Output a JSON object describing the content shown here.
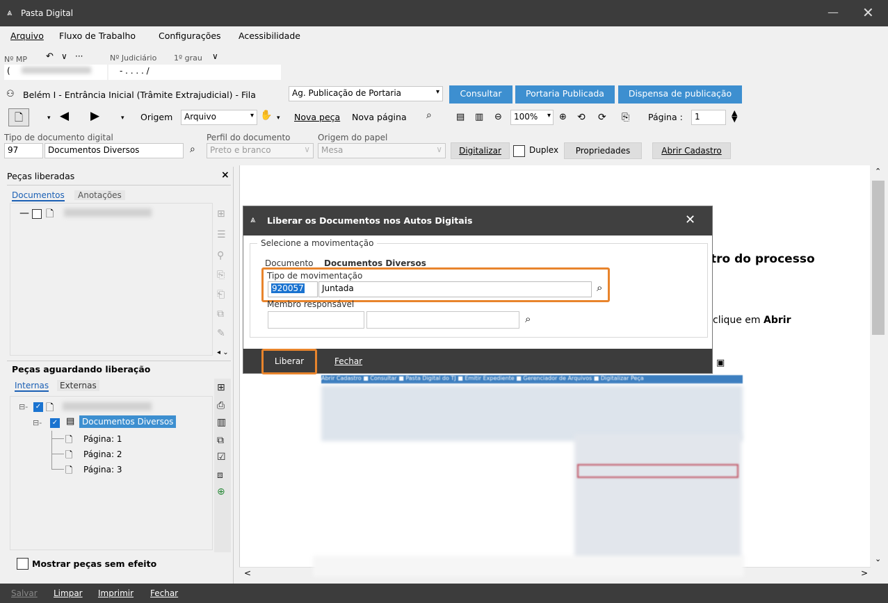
{
  "window": {
    "title": "Pasta Digital",
    "minimize": "—",
    "close": "✕"
  },
  "menu": {
    "items": [
      "Arquivo",
      "Fluxo de Trabalho",
      "Configurações",
      "Acessibilidade"
    ]
  },
  "mp": {
    "label": "Nº MP",
    "value": "(",
    "nav_back": "↶",
    "nav_down": "∨",
    "nav_more": "···"
  },
  "judicial": {
    "label": "Nº Judiciário",
    "grau": "1º grau",
    "chevron": "∨",
    "value": "-  .  . . .  /"
  },
  "fila": {
    "icon": "group-icon",
    "text": "Belém I - Entrância Inicial (Trâmite Extrajudicial) - Fila",
    "value": "Ag. Publicação de Portaria",
    "dropdown": "▾"
  },
  "actions": {
    "consultar": "Consultar",
    "portaria": "Portaria Publicada",
    "dispensa": "Dispensa de publicação"
  },
  "toolbar": {
    "origem_label": "Origem",
    "origem_value": "Arquivo",
    "nova_peca": "Nova peça",
    "nova_pagina": "Nova página",
    "zoom": "100%",
    "pagina_label": "Página :",
    "pagina_value": "1"
  },
  "docfields": {
    "tipo_label": "Tipo de documento digital",
    "tipo_code": "97",
    "tipo_value": "Documentos Diversos",
    "perfil_label": "Perfil do documento",
    "perfil_value": "Preto e branco",
    "origem_label": "Origem do papel",
    "origem_value": "Mesa",
    "digitalizar": "Digitalizar",
    "duplex": "Duplex",
    "propriedades": "Propriedades",
    "abrir_cadastro": "Abrir Cadastro"
  },
  "left": {
    "liberadas_title": "Peças liberadas",
    "close": "×",
    "tab_documentos": "Documentos",
    "tab_anotacoes": "Anotações",
    "aguardando_title": "Peças aguardando liberação",
    "tab_internas": "Internas",
    "tab_externas": "Externas",
    "doc_item": "Documentos Diversos",
    "pages": [
      "Página: 1",
      "Página: 2",
      "Página: 3"
    ],
    "mostrar": "Mostrar peças sem efeito"
  },
  "viewer": {
    "text1": "tro do processo",
    "text2a": "clique em ",
    "text2b": "Abrir",
    "strip": "Abrir Cadastro  ■  Consultar  ■  Pasta Digital do TJ  ■  Emitir Expediente  ■  Gerenciador de Arquivos  ■  Digitalizar Peça"
  },
  "dialog": {
    "title": "Liberar os Documentos nos Autos Digitais",
    "close": "✕",
    "group": "Selecione a movimentação",
    "doc_label": "Documento",
    "doc_value": "Documentos Diversos",
    "tipo_label": "Tipo de movimentação",
    "tipo_code": "920057",
    "tipo_value": "Juntada",
    "membro_label": "Membro responsável",
    "liberar": "Liberar",
    "fechar": "Fechar"
  },
  "footer": {
    "salvar": "Salvar",
    "limpar": "Limpar",
    "imprimir": "Imprimir",
    "fechar": "Fechar"
  },
  "colors": {
    "accent": "#3d8fd0",
    "highlight": "#e8842c",
    "dark": "#3c3c3c"
  }
}
